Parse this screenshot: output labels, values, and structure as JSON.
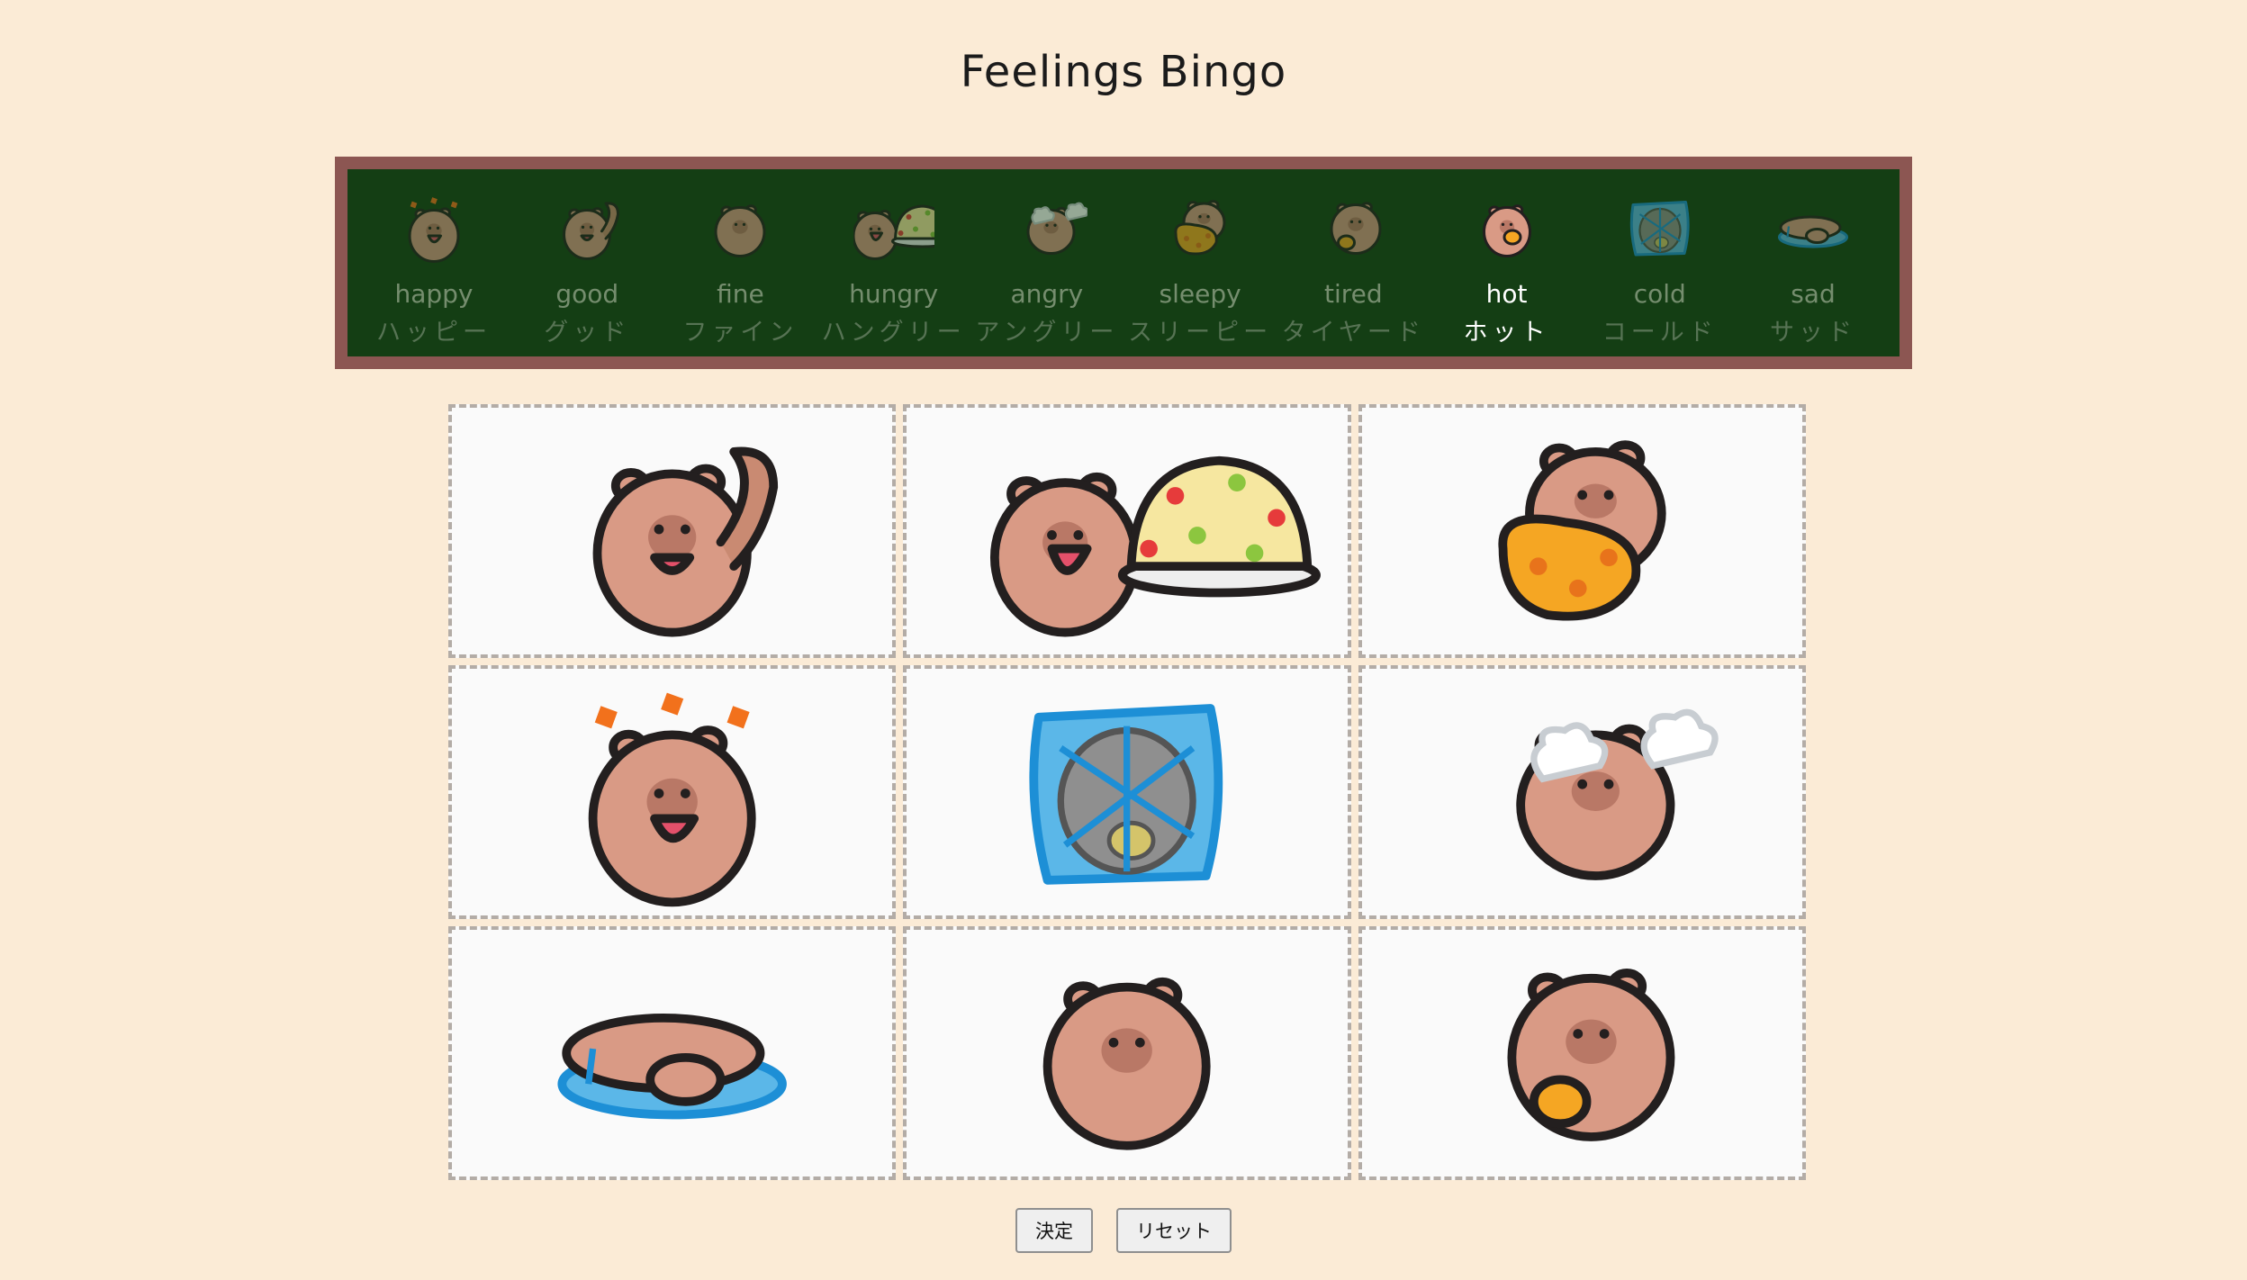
{
  "page": {
    "title": "Feelings Bingo"
  },
  "colors": {
    "background": "#fbebd6",
    "board": "#143e14",
    "board_border": "#8c5652",
    "capybara": "#d99a85",
    "outline": "#231f1f"
  },
  "feelings": [
    {
      "en": "happy",
      "ja": "ハッピー",
      "icon": "capybara-happy-icon",
      "active": false
    },
    {
      "en": "good",
      "ja": "グッド",
      "icon": "capybara-good-icon",
      "active": false
    },
    {
      "en": "fine",
      "ja": "ファイン",
      "icon": "capybara-fine-icon",
      "active": false
    },
    {
      "en": "hungry",
      "ja": "ハングリー",
      "icon": "capybara-hungry-icon",
      "active": false
    },
    {
      "en": "angry",
      "ja": "アングリー",
      "icon": "capybara-angry-icon",
      "active": false
    },
    {
      "en": "sleepy",
      "ja": "スリーピー",
      "icon": "capybara-sleepy-icon",
      "active": false
    },
    {
      "en": "tired",
      "ja": "タイヤード",
      "icon": "capybara-tired-icon",
      "active": false
    },
    {
      "en": "hot",
      "ja": "ホット",
      "icon": "capybara-hot-icon",
      "active": true
    },
    {
      "en": "cold",
      "ja": "コールド",
      "icon": "capybara-cold-icon",
      "active": false
    },
    {
      "en": "sad",
      "ja": "サッド",
      "icon": "capybara-sad-icon",
      "active": false
    }
  ],
  "grid": [
    {
      "feeling": "good",
      "icon": "capybara-good-icon"
    },
    {
      "feeling": "hungry",
      "icon": "capybara-hungry-icon"
    },
    {
      "feeling": "sleepy",
      "icon": "capybara-sleepy-icon"
    },
    {
      "feeling": "happy",
      "icon": "capybara-happy-icon"
    },
    {
      "feeling": "cold",
      "icon": "capybara-cold-icon"
    },
    {
      "feeling": "angry",
      "icon": "capybara-angry-icon"
    },
    {
      "feeling": "sad",
      "icon": "capybara-sad-icon"
    },
    {
      "feeling": "fine",
      "icon": "capybara-fine-icon"
    },
    {
      "feeling": "tired",
      "icon": "capybara-tired-icon"
    }
  ],
  "buttons": {
    "decide": "決定",
    "reset": "リセット"
  }
}
